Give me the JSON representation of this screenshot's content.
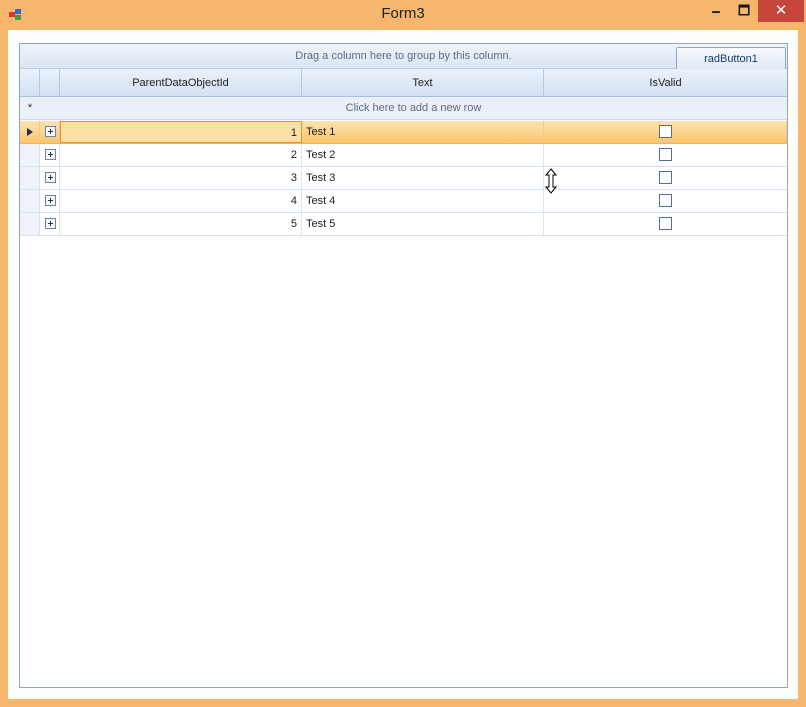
{
  "window": {
    "title": "Form3",
    "icon": "winforms-app-icon",
    "controls": {
      "minimize": "🗕",
      "maximize": "🗖",
      "close": "✕"
    }
  },
  "grid": {
    "group_panel_text": "Drag a column here to group by this column.",
    "button_label": "radButton1",
    "columns": [
      "ParentDataObjectId",
      "Text",
      "IsValid"
    ],
    "new_row_star": "*",
    "new_row_text": "Click here to add a new row",
    "rows": [
      {
        "id": "1",
        "text": "Test 1",
        "is_valid": false,
        "current": true
      },
      {
        "id": "2",
        "text": "Test 2",
        "is_valid": false,
        "current": false
      },
      {
        "id": "3",
        "text": "Test 3",
        "is_valid": false,
        "current": false
      },
      {
        "id": "4",
        "text": "Test 4",
        "is_valid": false,
        "current": false
      },
      {
        "id": "5",
        "text": "Test 5",
        "is_valid": false,
        "current": false
      }
    ]
  },
  "colors": {
    "window_frame": "#f6b66b",
    "close_button": "#c7463c",
    "current_row": "#fbc66c",
    "header": "#d4e1f3"
  },
  "icons": [
    "winforms-app-icon",
    "expand-plus-icon",
    "current-row-arrow-icon",
    "resize-cursor-icon"
  ]
}
